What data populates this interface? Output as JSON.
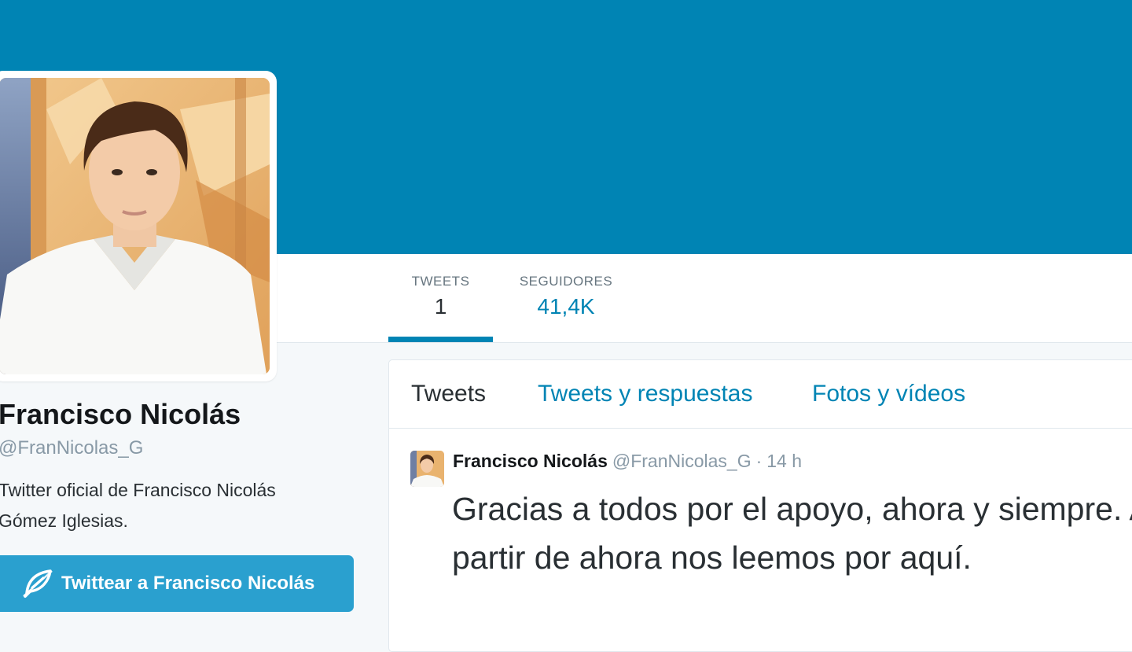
{
  "colors": {
    "banner": "#0084b4",
    "accent": "#0084b4",
    "button": "#2aa0cf",
    "page_background": "#f5f8fa"
  },
  "nav": {
    "tweets": {
      "label": "TWEETS",
      "value": "1"
    },
    "followers": {
      "label": "SEGUIDORES",
      "value": "41,4K"
    }
  },
  "profile": {
    "name": "Francisco Nicolás",
    "handle": "@FranNicolas_G",
    "bio": "Twitter oficial de Francisco Nicolás Gómez Iglesias.",
    "tweet_to_label": "Twittear a Francisco Nicolás",
    "tweet_to_icon": "quill-icon"
  },
  "timeline": {
    "tabs": [
      {
        "label": "Tweets"
      },
      {
        "label": "Tweets y respuestas"
      },
      {
        "label": "Fotos y vídeos"
      }
    ],
    "tweet": {
      "name": "Francisco Nicolás",
      "handle": "@FranNicolas_G",
      "separator": "·",
      "time": "14 h",
      "text": "Gracias a todos por el apoyo, ahora y siempre. A partir de ahora nos leemos por aquí."
    }
  }
}
